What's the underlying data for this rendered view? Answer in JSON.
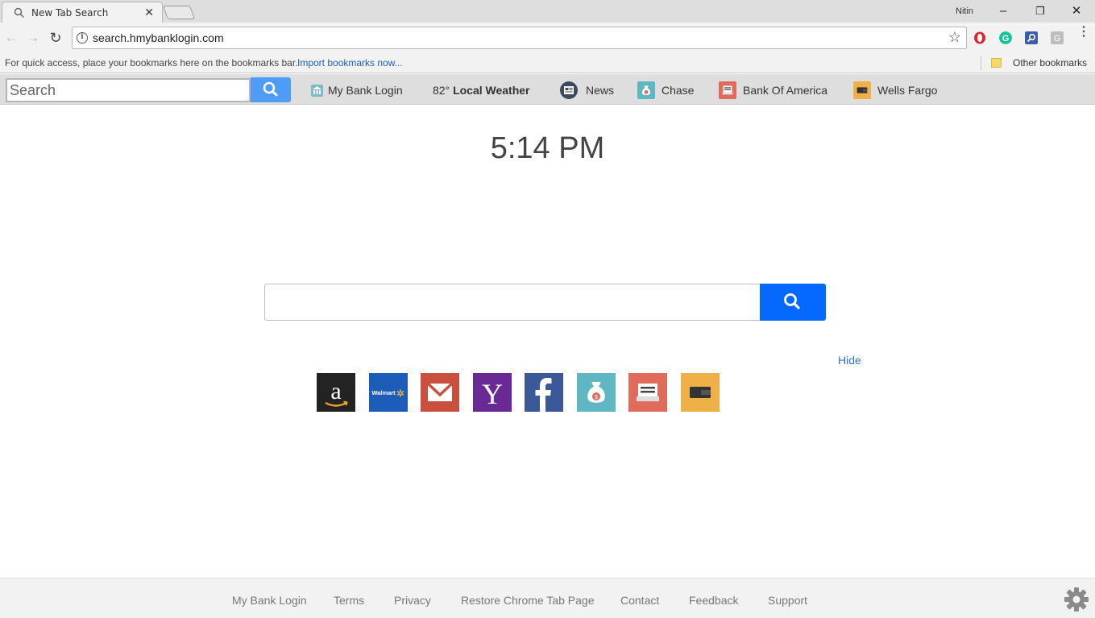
{
  "browser": {
    "tab_title": "New Tab Search",
    "tab_close": "✕",
    "user_name": "Nitin",
    "window_controls": {
      "minimize": "–",
      "restore": "❐",
      "close": "✕"
    },
    "url": "search.hmybanklogin.com",
    "star": "☆",
    "back": "←",
    "forward": "→",
    "reload": "↻",
    "menu": "⋮",
    "extensions": [
      {
        "name": "opera-icon",
        "color": "#e0242b"
      },
      {
        "name": "grammarly-icon",
        "color": "#15c39a"
      },
      {
        "name": "search-extension-icon",
        "color": "#3a5ea8"
      },
      {
        "name": "g-extension-icon",
        "color": "#9e9e9e"
      }
    ]
  },
  "bookmarks_bar": {
    "hint": "For quick access, place your bookmarks here on the bookmarks bar.",
    "import_link": "Import bookmarks now...",
    "other_bookmarks": "Other bookmarks"
  },
  "extension_toolbar": {
    "search_placeholder": "Search",
    "links": {
      "my_bank_login": "My Bank Login",
      "weather_temp": "82°",
      "weather_label": "Local Weather",
      "news": "News",
      "chase": "Chase",
      "bank_of_america": "Bank Of America",
      "wells_fargo": "Wells Fargo"
    }
  },
  "main": {
    "clock": "5:14 PM",
    "search_placeholder": "",
    "hide": "Hide",
    "tiles": [
      {
        "name": "amazon",
        "color": "#232323"
      },
      {
        "name": "walmart",
        "color": "#1d5cb9",
        "label": "Walmart"
      },
      {
        "name": "gmail",
        "color": "#c9503f"
      },
      {
        "name": "yahoo",
        "color": "#6a2a96"
      },
      {
        "name": "facebook",
        "color": "#3b5998"
      },
      {
        "name": "chase",
        "color": "#5fb7c4"
      },
      {
        "name": "bank-of-america",
        "color": "#e06a5c"
      },
      {
        "name": "wells-fargo",
        "color": "#efb046"
      }
    ]
  },
  "footer": {
    "links": {
      "my_bank_login": "My Bank Login",
      "terms": "Terms",
      "privacy": "Privacy",
      "restore": "Restore Chrome Tab Page",
      "contact": "Contact",
      "feedback": "Feedback",
      "support": "Support"
    }
  }
}
